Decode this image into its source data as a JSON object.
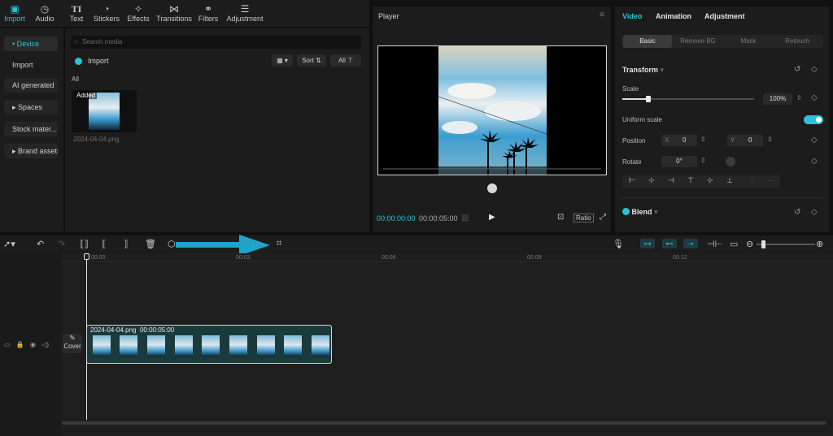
{
  "toolbar": {
    "tools": [
      {
        "label": "Import",
        "icon": "import-icon"
      },
      {
        "label": "Audio",
        "icon": "audio-icon"
      },
      {
        "label": "Text",
        "icon": "text-icon"
      },
      {
        "label": "Stickers",
        "icon": "stickers-icon"
      },
      {
        "label": "Effects",
        "icon": "effects-icon"
      },
      {
        "label": "Transitions",
        "icon": "transitions-icon"
      },
      {
        "label": "Filters",
        "icon": "filters-icon"
      },
      {
        "label": "Adjustment",
        "icon": "adjustment-icon"
      }
    ]
  },
  "sidebar": {
    "items": [
      {
        "label": "• Device"
      },
      {
        "label": "Import"
      },
      {
        "label": "AI generated"
      },
      {
        "label": "▸ Spaces"
      },
      {
        "label": "Stock mater..."
      },
      {
        "label": "▸ Brand assets"
      }
    ]
  },
  "media": {
    "search_placeholder": "Search media",
    "import_label": "Import",
    "sort_label": "Sort",
    "filter_label": "All",
    "section_label": "All",
    "item_badge": "Added",
    "item_name": "2024-04-04.png"
  },
  "player": {
    "title": "Player",
    "current_time": "00:00:00:00",
    "total_time": "00:00:05:00",
    "ratio_label": "Ratio"
  },
  "props": {
    "tabs": [
      "Video",
      "Animation",
      "Adjustment"
    ],
    "subtabs": [
      "Basic",
      "Remove BG",
      "Mask",
      "Retouch"
    ],
    "transform_label": "Transform",
    "scale_label": "Scale",
    "scale_value": "100%",
    "scale_fraction": 0.2,
    "uniform_scale_label": "Uniform scale",
    "position_label": "Position",
    "pos_x_label": "X",
    "pos_x_value": "0",
    "pos_y_label": "Y",
    "pos_y_value": "0",
    "rotate_label": "Rotate",
    "rotate_value": "0°",
    "blend_label": "Blend"
  },
  "timeline": {
    "ticks": [
      "00:00",
      "00:03",
      "00:06",
      "00:09",
      "00:12"
    ],
    "cover_label": "Cover",
    "clip_name": "2024-04-04.png",
    "clip_duration": "00:00:05:00"
  },
  "colors": {
    "accent": "#27c4d9",
    "arrow": "#1fa3c9"
  }
}
